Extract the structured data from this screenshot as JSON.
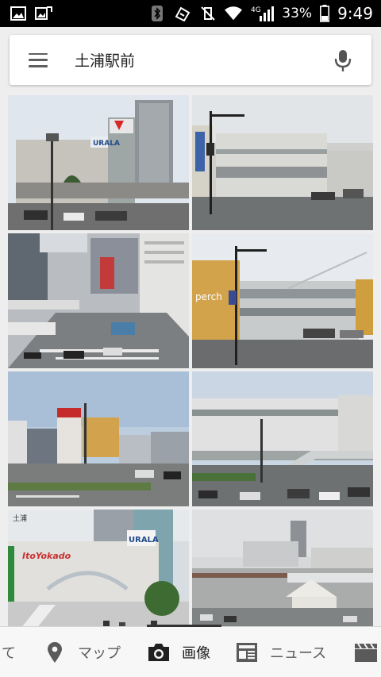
{
  "status_bar": {
    "network": "4G",
    "battery": "33%",
    "time": "9:49"
  },
  "search": {
    "query": "土浦駅前"
  },
  "bottom_nav": {
    "items": [
      {
        "label": "て",
        "icon": "partial-icon"
      },
      {
        "label": "マップ",
        "icon": "map-pin-icon"
      },
      {
        "label": "画像",
        "icon": "camera-icon",
        "active": true
      },
      {
        "label": "ニュース",
        "icon": "newspaper-icon"
      },
      {
        "label": "",
        "icon": "clapperboard-icon"
      }
    ]
  },
  "image_results": [
    {
      "id": "tile-1"
    },
    {
      "id": "tile-2"
    },
    {
      "id": "tile-3"
    },
    {
      "id": "tile-4"
    },
    {
      "id": "tile-5"
    },
    {
      "id": "tile-6"
    },
    {
      "id": "tile-7"
    },
    {
      "id": "tile-8"
    }
  ],
  "signage": {
    "perch": "perch",
    "ito_yokado": "ItoYokado",
    "urala": "URALA",
    "station_sign": "土浦"
  }
}
